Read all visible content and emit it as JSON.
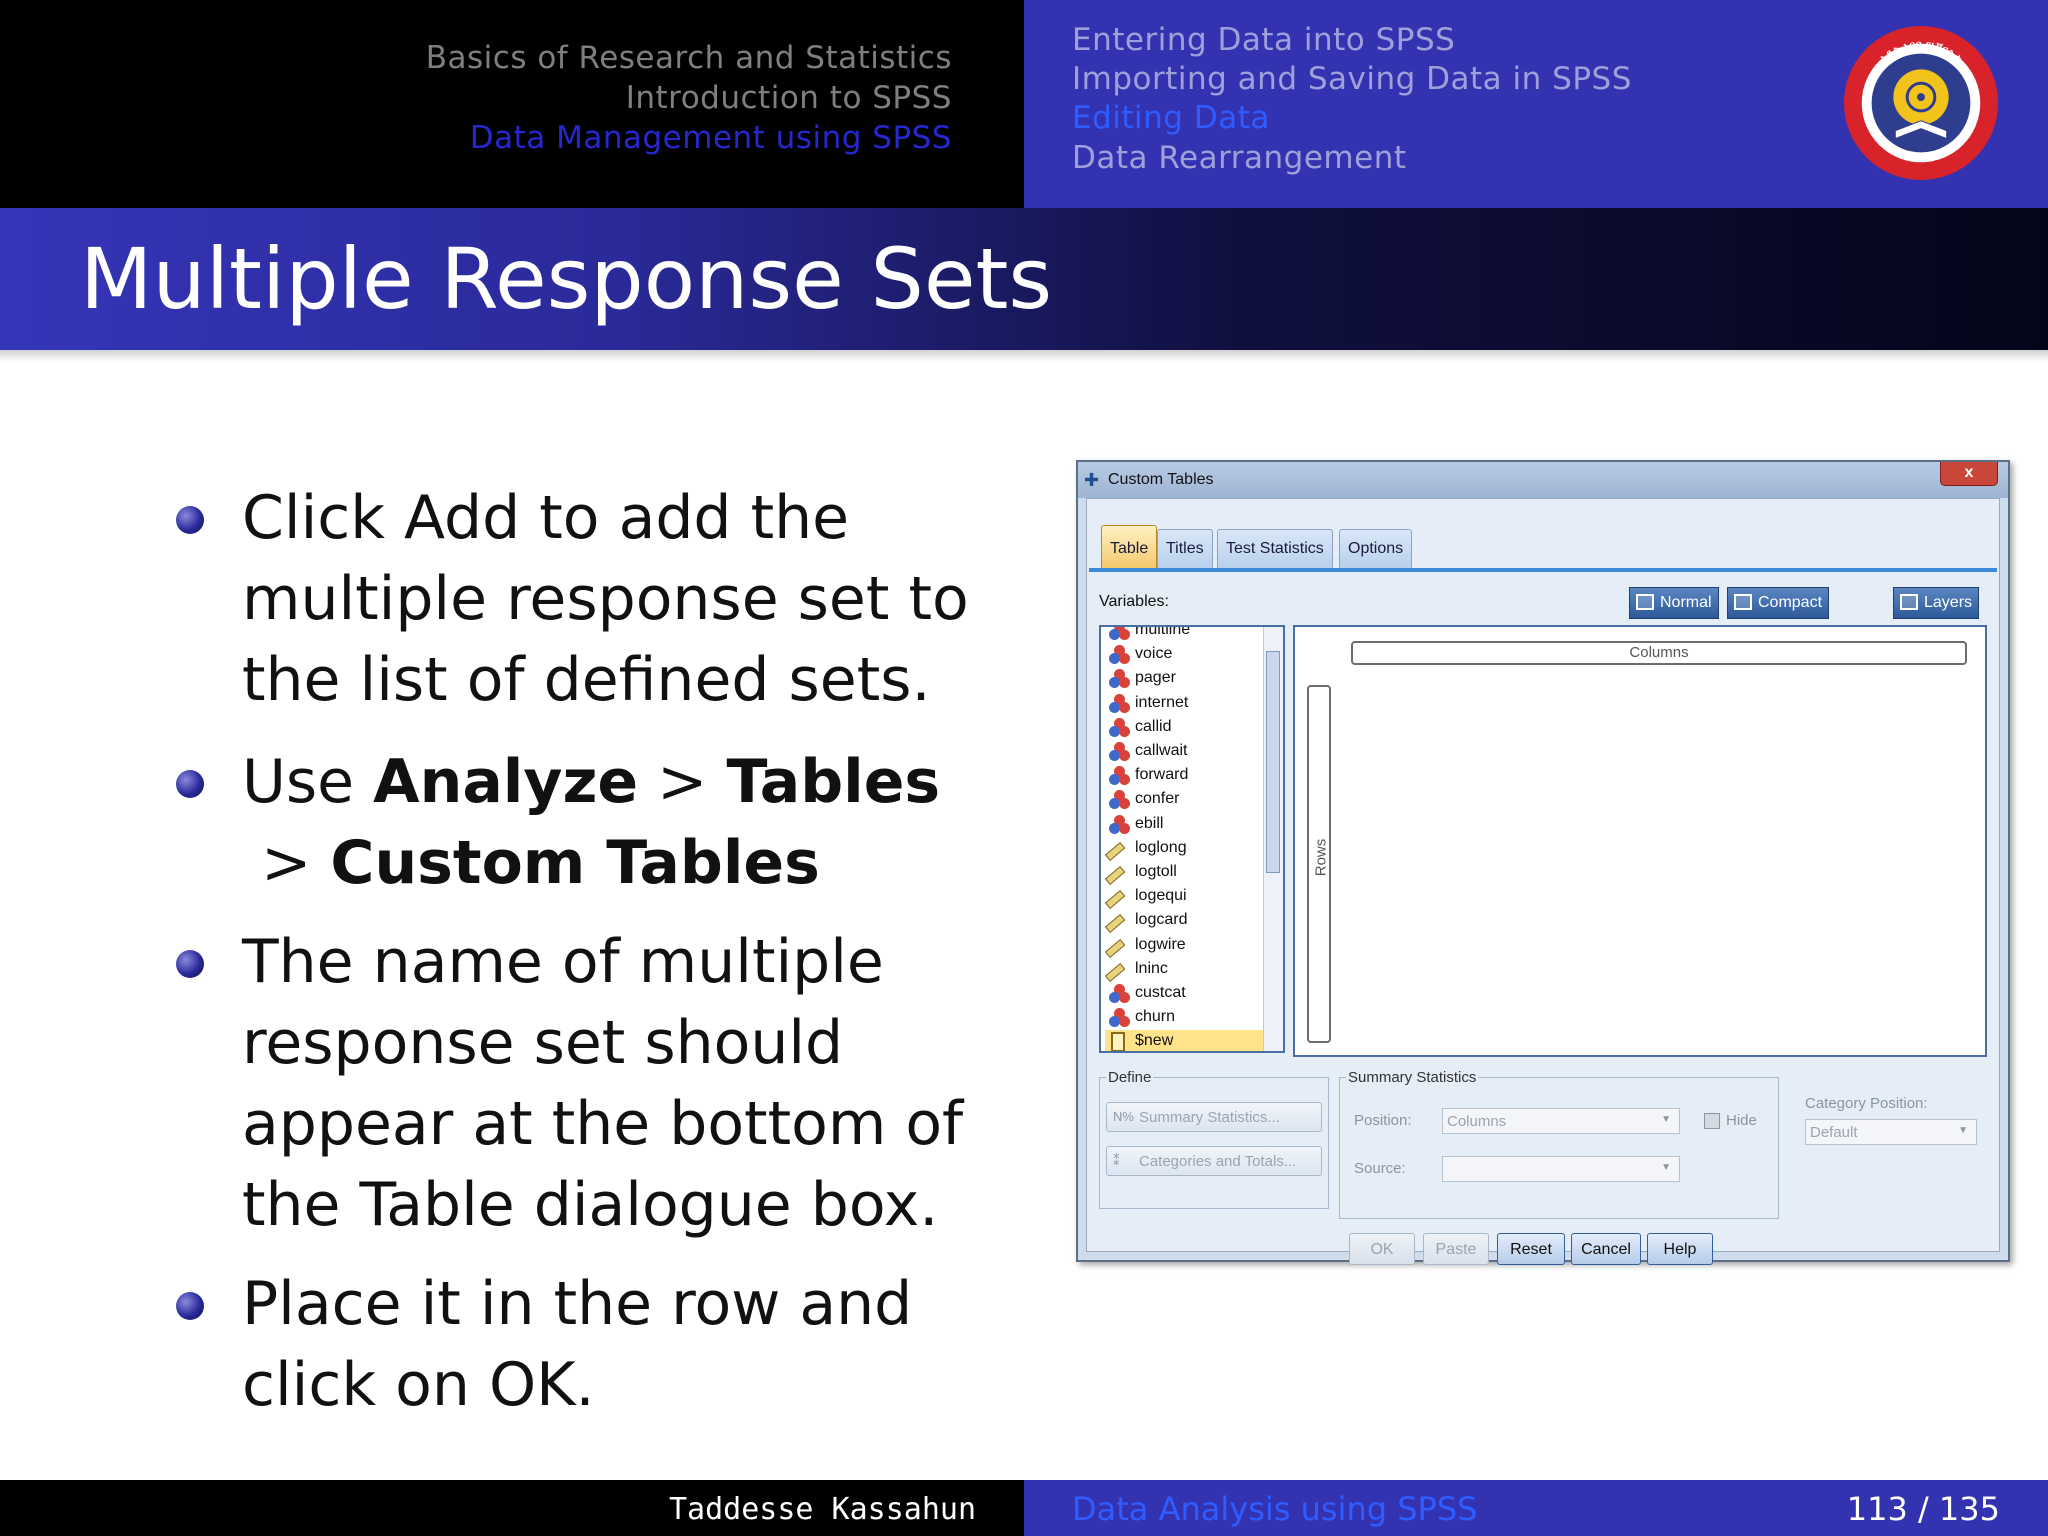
{
  "header": {
    "sections": [
      "Basics of Research and Statistics",
      "Introduction to SPSS",
      "Data Management using SPSS"
    ],
    "subsections": [
      "Entering Data into SPSS",
      "Importing and Saving Data in SPSS",
      "Editing Data",
      "Data Rearrangement"
    ],
    "active_section_index": 2,
    "active_subsection_index": 2,
    "logo_text": "ADDIS ABABA UNIVERSITY",
    "logo_amharic": "አዲስ አበባ ዩኒቨርሲቲ"
  },
  "title": "Multiple Response Sets",
  "bullets": [
    {
      "text": "Click Add to add the multiple response set to the list of defined sets."
    },
    {
      "pre": "Use ",
      "b1": "Analyze",
      "sep1": " > ",
      "b2": "Tables",
      "sep2": " > ",
      "b3": "Custom Tables"
    },
    {
      "text": "The name of multiple response set should appear at the bottom of the Table dialogue box."
    },
    {
      "text": "Place it in the row and click on OK."
    }
  ],
  "dialog": {
    "title": "Custom Tables",
    "close": "x",
    "tabs": [
      "Table",
      "Titles",
      "Test Statistics",
      "Options"
    ],
    "active_tab": "Table",
    "variables_label": "Variables:",
    "view_buttons": [
      "Normal",
      "Compact",
      "Layers"
    ],
    "variables": [
      {
        "name": "multline",
        "kind": "nominal"
      },
      {
        "name": "voice",
        "kind": "nominal"
      },
      {
        "name": "pager",
        "kind": "nominal"
      },
      {
        "name": "internet",
        "kind": "nominal"
      },
      {
        "name": "callid",
        "kind": "nominal"
      },
      {
        "name": "callwait",
        "kind": "nominal"
      },
      {
        "name": "forward",
        "kind": "nominal"
      },
      {
        "name": "confer",
        "kind": "nominal"
      },
      {
        "name": "ebill",
        "kind": "nominal"
      },
      {
        "name": "loglong",
        "kind": "scale"
      },
      {
        "name": "logtoll",
        "kind": "scale"
      },
      {
        "name": "logequi",
        "kind": "scale"
      },
      {
        "name": "logcard",
        "kind": "scale"
      },
      {
        "name": "logwire",
        "kind": "scale"
      },
      {
        "name": "lninc",
        "kind": "scale"
      },
      {
        "name": "custcat",
        "kind": "nominal"
      },
      {
        "name": "churn",
        "kind": "nominal"
      },
      {
        "name": "$new",
        "kind": "set",
        "selected": true
      }
    ],
    "columns_label": "Columns",
    "rows_label": "Rows",
    "define": {
      "legend": "Define",
      "summary_btn": "Summary Statistics...",
      "summary_icon": "N%",
      "categories_btn": "Categories and Totals..."
    },
    "summary": {
      "legend": "Summary Statistics",
      "position_label": "Position:",
      "position_value": "Columns",
      "hide_label": "Hide",
      "source_label": "Source:",
      "source_value": ""
    },
    "category_position": {
      "label": "Category Position:",
      "value": "Default"
    },
    "action_buttons": [
      "OK",
      "Paste",
      "Reset",
      "Cancel",
      "Help"
    ]
  },
  "footer": {
    "author": "Taddesse Kassahun",
    "title": "Data Analysis using SPSS",
    "page": "113 / 135"
  },
  "colors": {
    "accent": "#3333b2",
    "active_nav": "#2f5cff",
    "dark": "#000000"
  }
}
